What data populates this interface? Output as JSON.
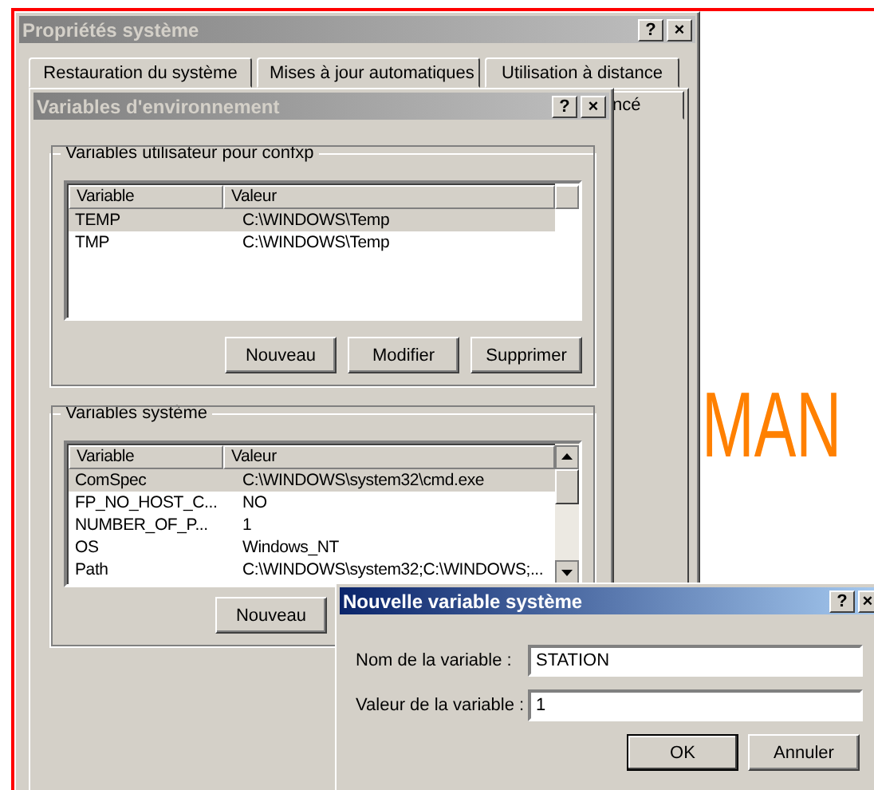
{
  "backdrop_text": "MAN",
  "system_properties": {
    "title": "Propriétés système",
    "active": false,
    "title_buttons": [
      "?",
      "×"
    ],
    "tabs": [
      {
        "label": "Restauration du système",
        "selected": false
      },
      {
        "label": "Mises à jour automatiques",
        "selected": false
      },
      {
        "label": "Utilisation à distance",
        "selected": false
      }
    ],
    "partial_tab": "ncé"
  },
  "environment_dialog": {
    "title": "Variables d'environnement",
    "active": false,
    "title_buttons": [
      "?",
      "×"
    ],
    "groups": [
      {
        "legend": "Variables utilisateur pour confxp",
        "columns": [
          "Variable",
          "Valeur"
        ],
        "scrollbar": false,
        "rows": [
          {
            "name": "TEMP",
            "value": "C:\\WINDOWS\\Temp",
            "selected": true
          },
          {
            "name": "TMP",
            "value": "C:\\WINDOWS\\Temp",
            "selected": false
          }
        ],
        "buttons": [
          "Nouveau",
          "Modifier",
          "Supprimer"
        ]
      },
      {
        "legend": "Variables système",
        "columns": [
          "Variable",
          "Valeur"
        ],
        "scrollbar": true,
        "rows": [
          {
            "name": "ComSpec",
            "value": "C:\\WINDOWS\\system32\\cmd.exe",
            "selected": true
          },
          {
            "name": "FP_NO_HOST_C...",
            "value": "NO",
            "selected": false
          },
          {
            "name": "NUMBER_OF_P...",
            "value": "1",
            "selected": false
          },
          {
            "name": "OS",
            "value": "Windows_NT",
            "selected": false
          },
          {
            "name": "Path",
            "value": "C:\\WINDOWS\\system32;C:\\WINDOWS;...",
            "selected": false
          }
        ],
        "buttons": [
          "Nouveau"
        ]
      }
    ]
  },
  "new_variable_dialog": {
    "title": "Nouvelle variable système",
    "active": true,
    "title_buttons": [
      "?",
      "×"
    ],
    "fields": [
      {
        "label": "Nom de la variable :",
        "value": "STATION"
      },
      {
        "label": "Valeur de la variable :",
        "value": "1"
      }
    ],
    "buttons": [
      {
        "label": "OK",
        "default": true
      },
      {
        "label": "Annuler",
        "default": false
      }
    ]
  }
}
